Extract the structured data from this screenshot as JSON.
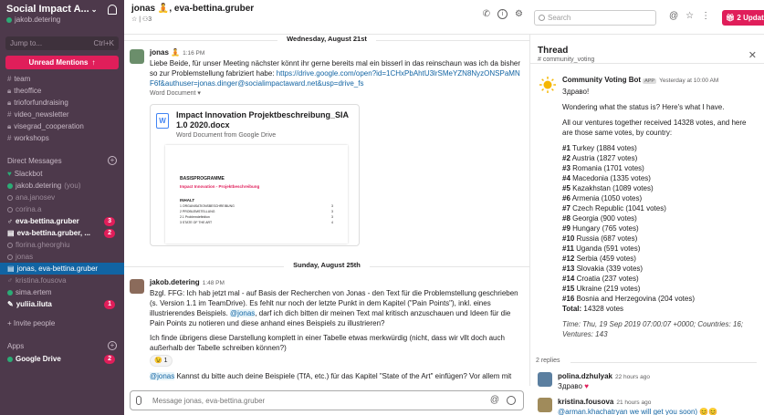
{
  "workspace": {
    "name": "Social Impact A...",
    "user": "jakob.detering"
  },
  "sidebar": {
    "jump_label": "Jump to...",
    "jump_shortcut": "Ctrl+K",
    "unread_label": "Unread Mentions",
    "channels": [
      {
        "label": "team"
      },
      {
        "label": "theoffice"
      },
      {
        "label": "trioforfundraising"
      },
      {
        "label": "video_newsletter"
      },
      {
        "label": "visegrad_cooperation"
      },
      {
        "label": "workshops"
      }
    ],
    "dm_header": "Direct Messages",
    "dms": [
      {
        "label": "Slackbot"
      },
      {
        "label": "jakob.detering",
        "suffix": "(you)"
      },
      {
        "label": "ana.janosev"
      },
      {
        "label": "corina.a"
      },
      {
        "label": "eva-bettina.gruber",
        "badge": "3"
      },
      {
        "label": "eva-bettina.gruber, ...",
        "badge": "2"
      },
      {
        "label": "florina.gheorghiu"
      },
      {
        "label": "jonas"
      },
      {
        "label": "jonas, eva-bettina.gruber"
      },
      {
        "label": "kristina.fousova"
      },
      {
        "label": "sima.ertem"
      },
      {
        "label": "yuliia.iluta",
        "badge": "1"
      }
    ],
    "invite_label": "+ Invite people",
    "apps_header": "Apps",
    "apps": [
      {
        "label": "Google Drive",
        "badge": "2"
      }
    ]
  },
  "header": {
    "title": "jonas 🧘, eva-bettina.gruber",
    "members": "3"
  },
  "topright": {
    "search_placeholder": "Search",
    "updates_label": "2 Updat"
  },
  "messages": {
    "date1": "Wednesday, August 21st",
    "date2": "Sunday, August 25th",
    "msg1": {
      "author": "jonas 🧘",
      "time": "1:16 PM",
      "text": "Liebe Beide, für unser Meeting nächster könnt ihr gerne bereits mal ein bisserl in das reinschaun was ich da bisher so zur Problemstellung fabriziert habe: ",
      "link": "https://drive.google.com/open?id=1CHxPbAhtU3lrSMeYZN8NyzONSPaMNF6f&authuser=jonas.dinger@socialimpactaward.net&usp=drive_fs",
      "attachment_meta": "Word Document ▾",
      "doc_title": "Impact Innovation Projektbeschreibung_SIA 1.0 2020.docx",
      "doc_sub": "Word Document from Google Drive",
      "preview_title": "BASISPROGRAMME",
      "preview_sub": "Impact Innovation - Projektbeschreibung",
      "preview_inhalt": "INHALT",
      "preview_lines": [
        "1   ORGANISATIONSBESCHREIBUNG",
        "2   PROBLEMSTELLUNG",
        "2.1  Problemdefinition",
        "3   STATE OF THE ART"
      ]
    },
    "msg2": {
      "author": "jakob.detering",
      "time": "1:48 PM",
      "text_a": "Bzgl. FFG: Ich hab jetzt mal - auf Basis der Recherchen von Jonas - den Text für die Problemstellung geschrieben (s. Version 1.1 im TeamDrive). Es fehlt nur noch der letzte Punkt in dem Kapitel (\"Pain Points\"), inkl. eines illustrierendes Beispiels. ",
      "mention": "@jonas",
      "text_b": ", darf ich dich bitten dir meinen Text mal kritisch anzuschauen und Ideen für die Pain Points zu notieren und diese anhand eines Beispiels zu illustrieren?",
      "text_c": "Ich finde übrigens diese Darstellung komplett in einer Tabelle etwas merkwürdig (nicht, dass wir vllt doch auch außerhalb der Tabelle schreiben können?)",
      "reaction": "😉 1",
      "mention2": "@jonas",
      "text_d": " Kannst du bitte auch deine Beispiele (TfA, etc.) für das Kapitel \"State of the Art\" einfügen? Vor allem mit"
    },
    "composer_placeholder": "Message jonas, eva-bettina.gruber"
  },
  "thread": {
    "title": "Thread",
    "channel": "# community_voting",
    "bot": {
      "author": "Community Voting Bot",
      "app_badge": "APP",
      "time": "Yesterday at 10:00 AM",
      "greeting": "Здраво!",
      "line1": "Wondering what the status is? Here's what I have.",
      "line2": "All our ventures together received 14328 votes, and here are those same votes, by country:",
      "countries": [
        {
          "rank": "#1",
          "name": "Turkey (1884 votes)"
        },
        {
          "rank": "#2",
          "name": "Austria (1827 votes)"
        },
        {
          "rank": "#3",
          "name": "Romania (1701 votes)"
        },
        {
          "rank": "#4",
          "name": "Macedonia (1335 votes)"
        },
        {
          "rank": "#5",
          "name": "Kazakhstan (1089 votes)"
        },
        {
          "rank": "#6",
          "name": "Armenia (1050 votes)"
        },
        {
          "rank": "#7",
          "name": "Czech Republic (1041 votes)"
        },
        {
          "rank": "#8",
          "name": "Georgia (900 votes)"
        },
        {
          "rank": "#9",
          "name": "Hungary (765 votes)"
        },
        {
          "rank": "#10",
          "name": "Russia (687 votes)"
        },
        {
          "rank": "#11",
          "name": "Uganda (591 votes)"
        },
        {
          "rank": "#12",
          "name": "Serbia (459 votes)"
        },
        {
          "rank": "#13",
          "name": "Slovakia (339 votes)"
        },
        {
          "rank": "#14",
          "name": "Croatia (237 votes)"
        },
        {
          "rank": "#15",
          "name": "Ukraine (219 votes)"
        },
        {
          "rank": "#16",
          "name": "Bosnia and Herzegovina (204 votes)"
        }
      ],
      "total_label": "Total:",
      "total_value": "14328 votes",
      "footer": "Time: Thu, 19 Sep 2019 07:00:07 +0000; Countries: 16; Ventures: 143"
    },
    "replies_label": "2 replies",
    "replies": [
      {
        "author": "polina.dzhulyak",
        "time": "22 hours ago",
        "text": "Здраво"
      },
      {
        "author": "kristina.fousova",
        "time": "21 hours ago",
        "text": "@arman.khachatryan we will get you soon) 😊😊"
      }
    ]
  }
}
